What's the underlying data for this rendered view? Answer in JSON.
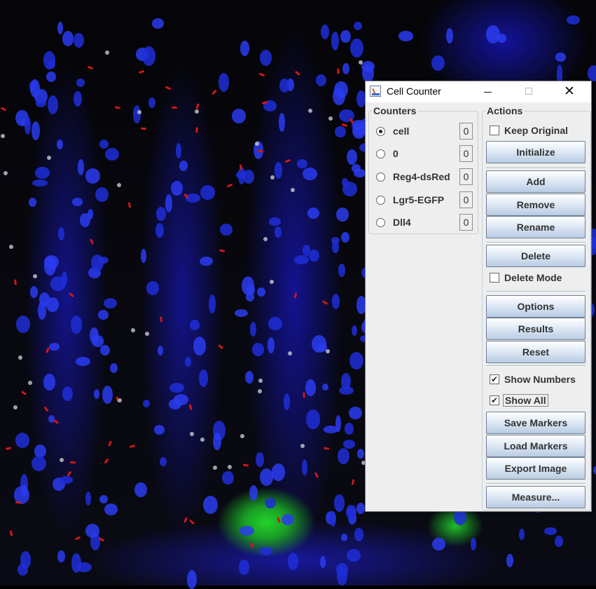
{
  "window": {
    "title": "Cell Counter",
    "close_symbol": "✕"
  },
  "counters": {
    "title": "Counters",
    "items": [
      {
        "label": "cell",
        "count": "0",
        "selected": true
      },
      {
        "label": "0",
        "count": "0",
        "selected": false
      },
      {
        "label": "Reg4-dsRed",
        "count": "0",
        "selected": false
      },
      {
        "label": "Lgr5-EGFP",
        "count": "0",
        "selected": false
      },
      {
        "label": "Dll4",
        "count": "0",
        "selected": false
      }
    ]
  },
  "actions": {
    "title": "Actions",
    "keep_original": {
      "label": "Keep Original",
      "checked": false
    },
    "initialize": "Initialize",
    "add": "Add",
    "remove": "Remove",
    "rename": "Rename",
    "delete": "Delete",
    "delete_mode": {
      "label": "Delete Mode",
      "checked": false
    },
    "options": "Options",
    "results": "Results",
    "reset": "Reset",
    "show_numbers": {
      "label": "Show Numbers",
      "checked": true
    },
    "show_all": {
      "label": "Show All",
      "checked": true
    },
    "save_markers": "Save Markers",
    "load_markers": "Load Markers",
    "export_image": "Export Image",
    "measure": "Measure..."
  },
  "checkmark": "✔"
}
